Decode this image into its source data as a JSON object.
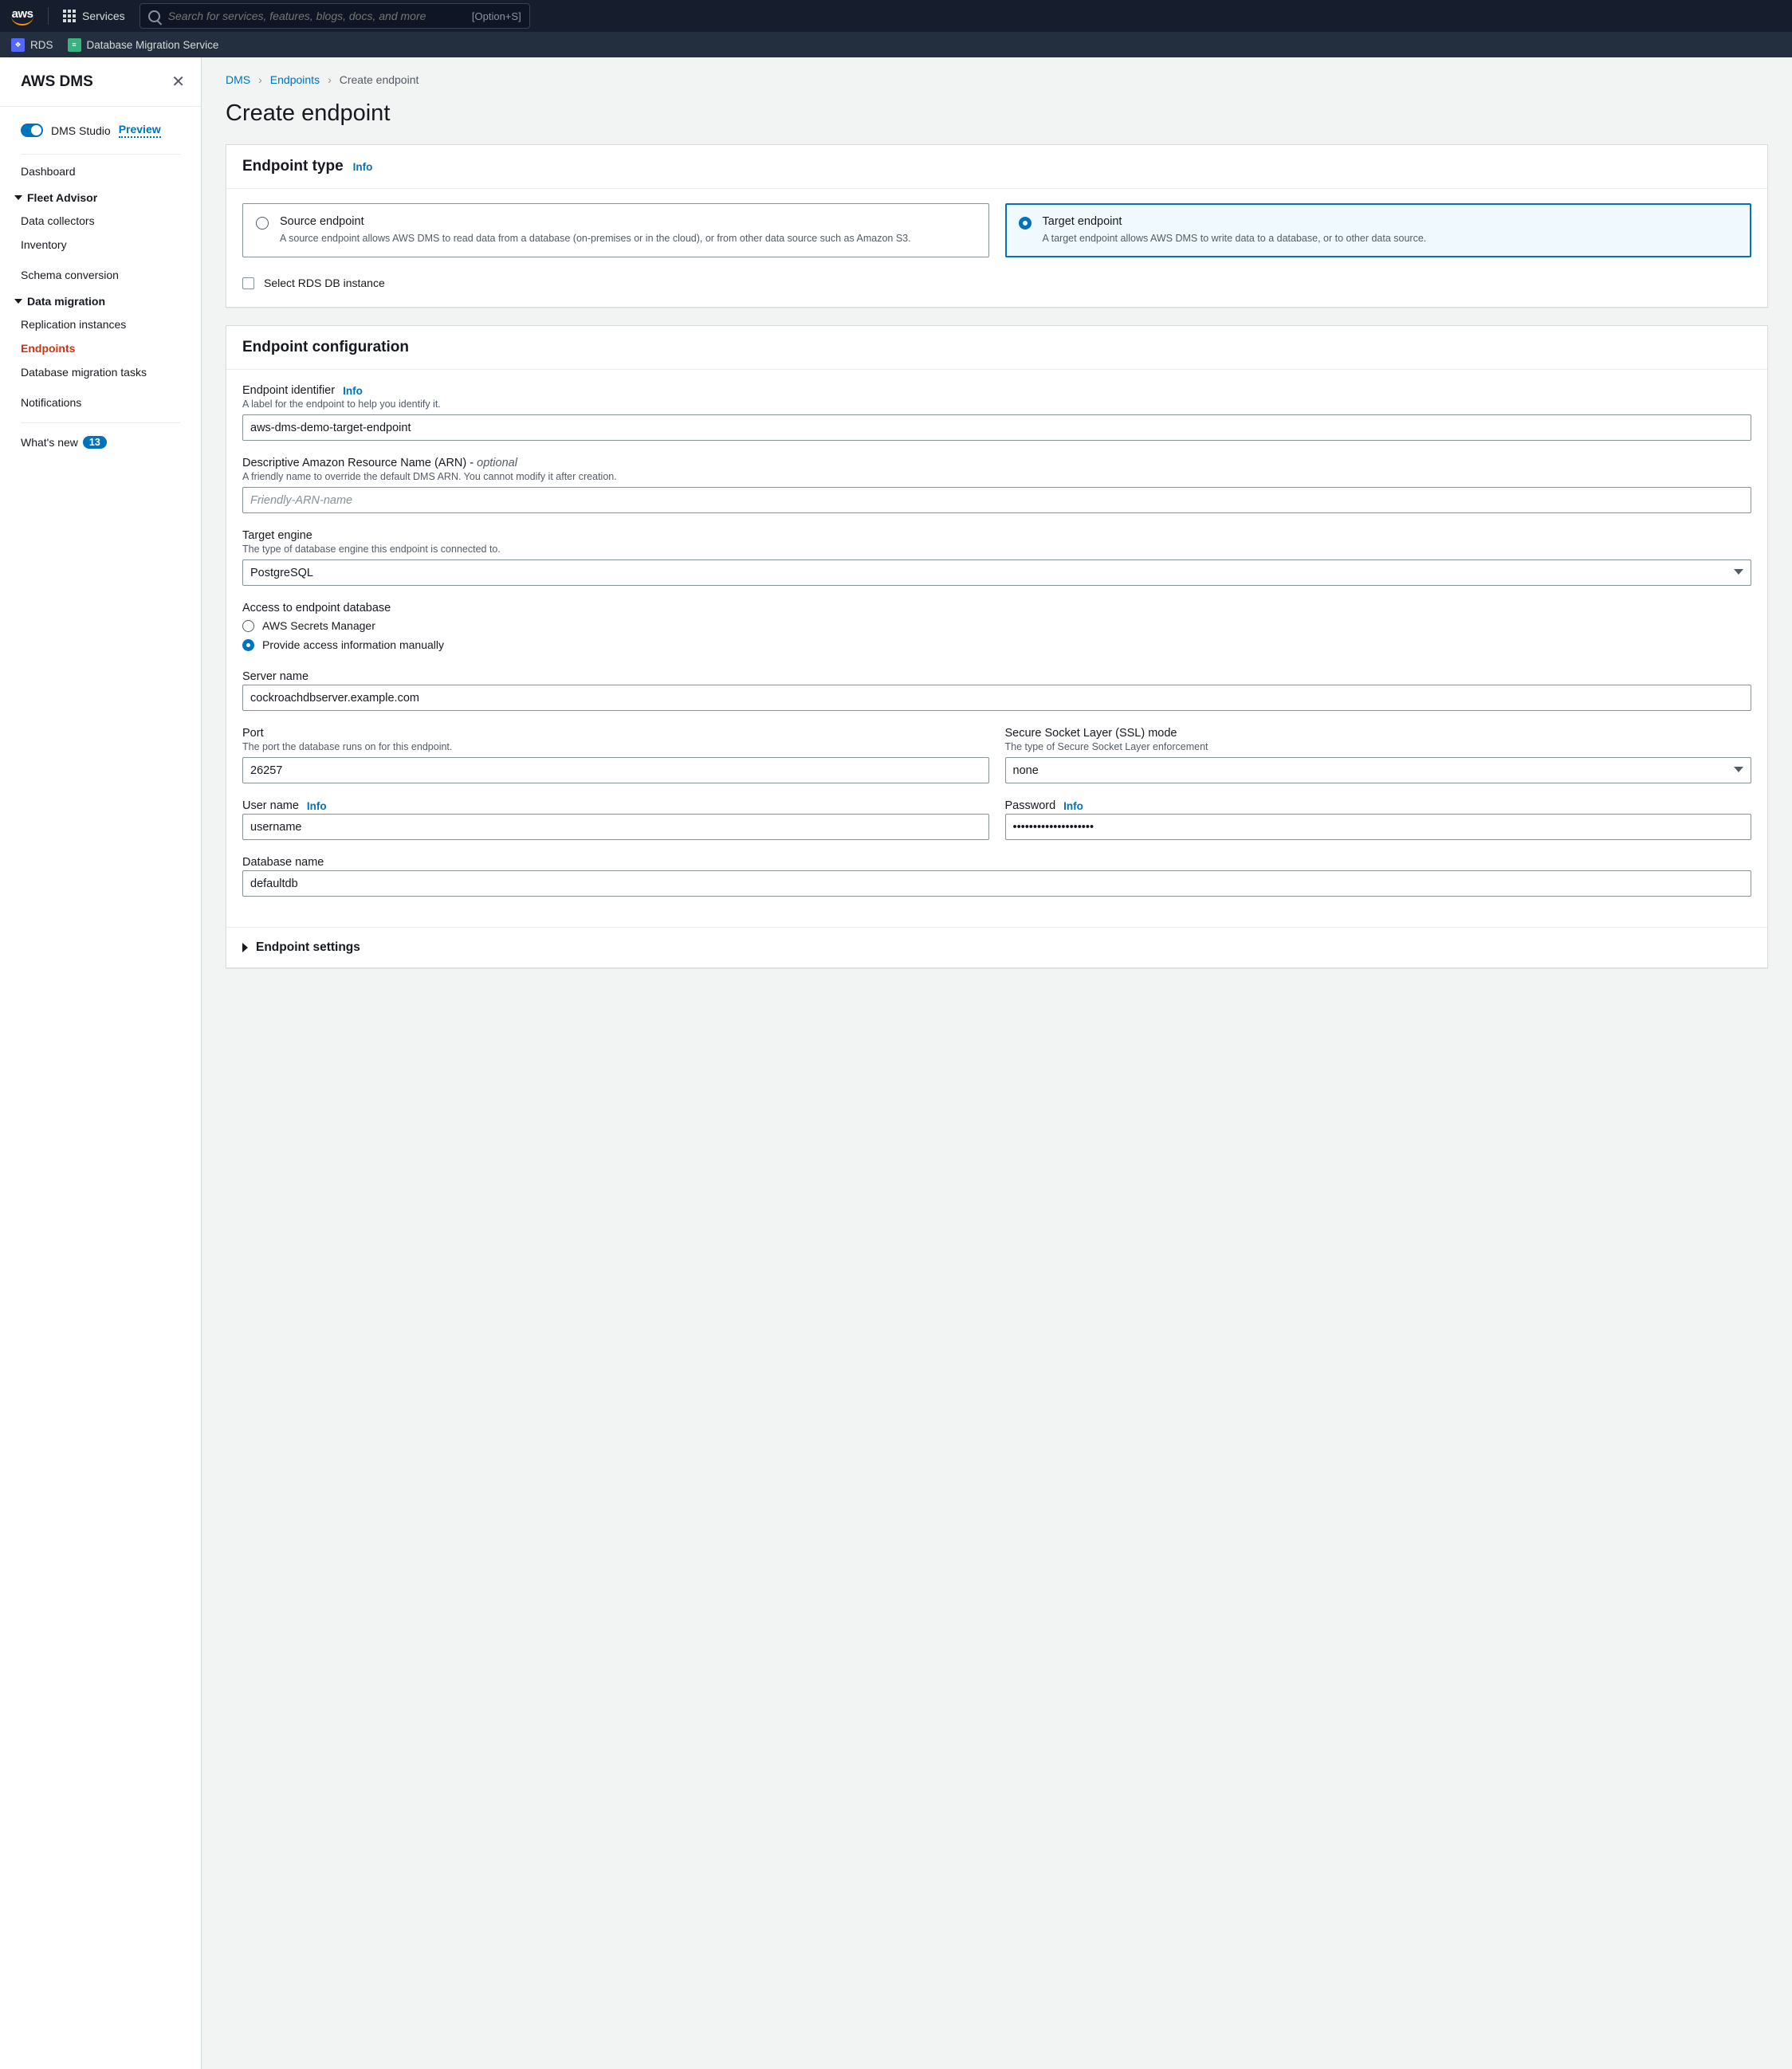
{
  "topbar": {
    "services": "Services",
    "search_placeholder": "Search for services, features, blogs, docs, and more",
    "shortcut": "[Option+S]"
  },
  "svcbar": {
    "rds": "RDS",
    "dms": "Database Migration Service"
  },
  "sidebar": {
    "title": "AWS DMS",
    "dms_studio": "DMS Studio",
    "preview": "Preview",
    "dashboard": "Dashboard",
    "fleet_advisor": "Fleet Advisor",
    "data_collectors": "Data collectors",
    "inventory": "Inventory",
    "schema_conversion": "Schema conversion",
    "data_migration": "Data migration",
    "replication_instances": "Replication instances",
    "endpoints": "Endpoints",
    "db_tasks": "Database migration tasks",
    "notifications": "Notifications",
    "whats_new": "What's new",
    "whats_new_count": "13"
  },
  "crumbs": {
    "dms": "DMS",
    "endpoints": "Endpoints",
    "create": "Create endpoint"
  },
  "page": {
    "title": "Create endpoint"
  },
  "endpoint_type": {
    "heading": "Endpoint type",
    "info": "Info",
    "source": {
      "title": "Source endpoint",
      "desc": "A source endpoint allows AWS DMS to read data from a database (on-premises or in the cloud), or from other data source such as Amazon S3."
    },
    "target": {
      "title": "Target endpoint",
      "desc": "A target endpoint allows AWS DMS to write data to a database, or to other data source."
    },
    "select_rds": "Select RDS DB instance"
  },
  "config": {
    "heading": "Endpoint configuration",
    "id_label": "Endpoint identifier",
    "id_info": "Info",
    "id_help": "A label for the endpoint to help you identify it.",
    "id_value": "aws-dms-demo-target-endpoint",
    "arn_label": "Descriptive Amazon Resource Name (ARN) - ",
    "arn_opt": "optional",
    "arn_help": "A friendly name to override the default DMS ARN. You cannot modify it after creation.",
    "arn_placeholder": "Friendly-ARN-name",
    "engine_label": "Target engine",
    "engine_help": "The type of database engine this endpoint is connected to.",
    "engine_value": "PostgreSQL",
    "access_label": "Access to endpoint database",
    "access_secrets": "AWS Secrets Manager",
    "access_manual": "Provide access information manually",
    "server_label": "Server name",
    "server_value": "cockroachdbserver.example.com",
    "port_label": "Port",
    "port_help": "The port the database runs on for this endpoint.",
    "port_value": "26257",
    "ssl_label": "Secure Socket Layer (SSL) mode",
    "ssl_help": "The type of Secure Socket Layer enforcement",
    "ssl_value": "none",
    "user_label": "User name",
    "user_info": "Info",
    "user_value": "username",
    "pass_label": "Password",
    "pass_info": "Info",
    "pass_value": "••••••••••••••••••••",
    "db_label": "Database name",
    "db_value": "defaultdb",
    "endpoint_settings": "Endpoint settings"
  }
}
